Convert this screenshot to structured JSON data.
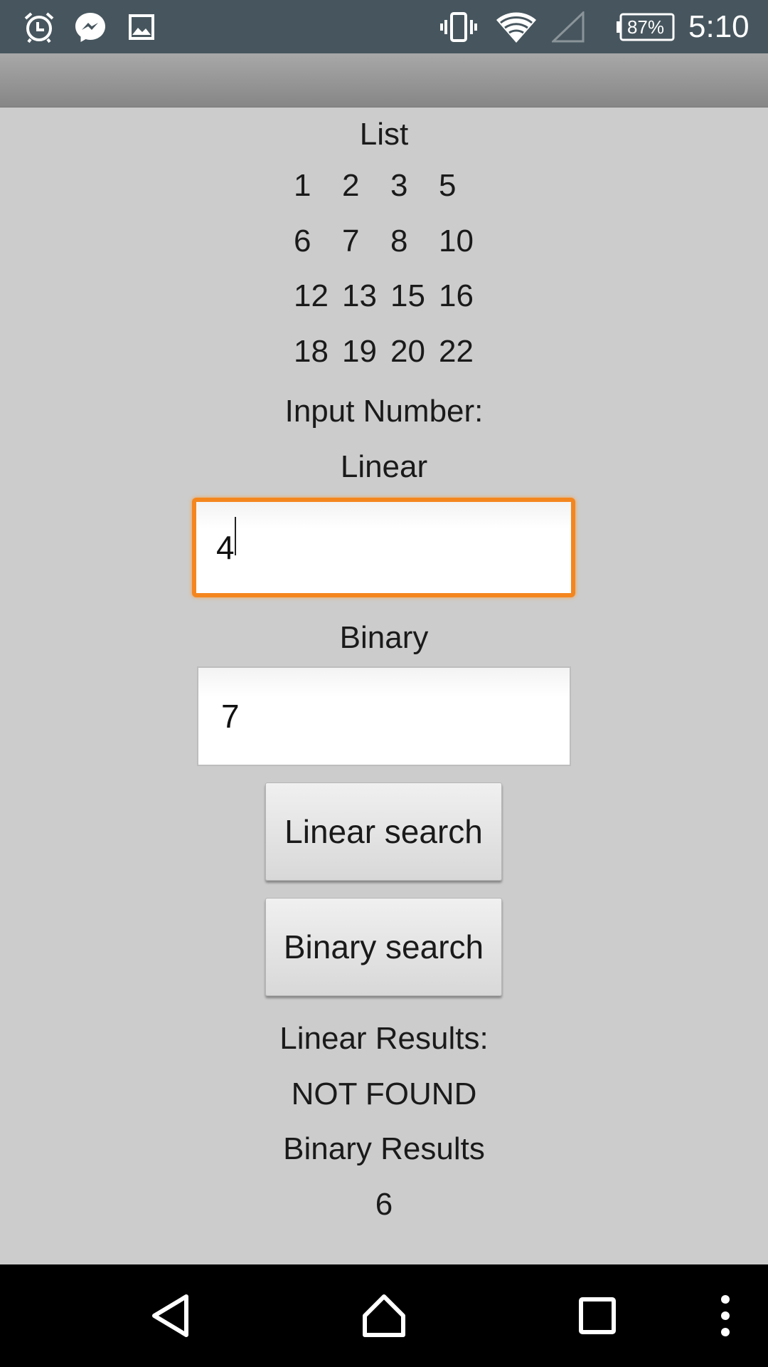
{
  "status_bar": {
    "icons_left": [
      "alarm-icon",
      "messenger-icon",
      "gallery-icon"
    ],
    "icons_right": [
      "vibrate-icon",
      "wifi-icon",
      "cell-signal-icon"
    ],
    "battery": "87%",
    "time": "5:10"
  },
  "main": {
    "list_title": "List",
    "list_numbers": [
      "1",
      "2",
      "3",
      "5",
      "6",
      "7",
      "8",
      "10",
      "12",
      "13",
      "15",
      "16",
      "18",
      "19",
      "20",
      "22"
    ],
    "input_number_label": "Input Number:",
    "linear_label": "Linear",
    "linear_input_value": "4",
    "binary_label": "Binary",
    "binary_input_value": "7",
    "linear_search_button": "Linear search",
    "binary_search_button": "Binary search",
    "linear_results_label": "Linear Results:",
    "linear_results_value": "NOT FOUND",
    "binary_results_label": "Binary Results",
    "binary_results_value": "6"
  },
  "nav_bar": {
    "buttons": [
      "back-icon",
      "home-icon",
      "recents-icon",
      "overflow-menu-icon"
    ]
  },
  "colors": {
    "background": "#cccccc",
    "status_bar": "#47565e",
    "focus_border": "#f4861e"
  }
}
